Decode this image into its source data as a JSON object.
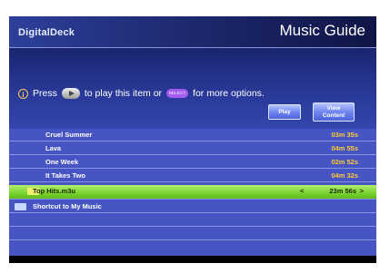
{
  "header": {
    "brand": "DigitalDeck",
    "title": "Music Guide"
  },
  "prompt": {
    "info_icon": "i",
    "part1": "Press",
    "part2": "to play this item or",
    "part3": "for more options.",
    "select_icon": "SELECT"
  },
  "buttons": {
    "play": "Play",
    "view_line1": "View",
    "view_line2": "Content"
  },
  "list": {
    "rows": [
      {
        "name": "Cruel Summer",
        "duration": "03m 35s"
      },
      {
        "name": "Lava",
        "duration": "04m 55s"
      },
      {
        "name": "One Week",
        "duration": "02m 52s"
      },
      {
        "name": "It Takes Two",
        "duration": "04m 32s"
      }
    ],
    "selected": {
      "name": "Top Hits.m3u",
      "duration": "23m 56s",
      "left_marker": "<",
      "right_marker": ">"
    },
    "shortcut": {
      "name": "Shortcut to My Music"
    }
  },
  "icons": {
    "info": "info-icon",
    "play": "play-remote-icon",
    "select": "select-remote-icon",
    "folder": "folder-icon"
  },
  "colors": {
    "header": "#2d3f9a",
    "list": "#4654c4",
    "selected": "#78d22e",
    "duration": "#ffcc33"
  }
}
